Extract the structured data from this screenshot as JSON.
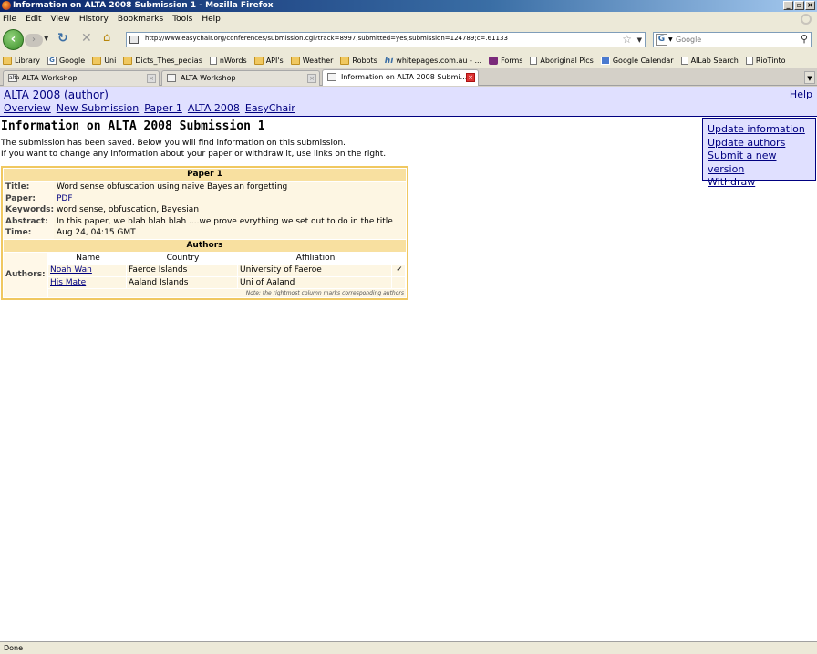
{
  "window": {
    "title": "Information on ALTA 2008 Submission 1 - Mozilla Firefox"
  },
  "menu": [
    "File",
    "Edit",
    "View",
    "History",
    "Bookmarks",
    "Tools",
    "Help"
  ],
  "toolbar": {
    "url": "http://www.easychair.org/conferences/submission.cgi?track=8997;submitted=yes;submission=124789;c=.61133",
    "search_placeholder": "Google"
  },
  "bookmarks": [
    {
      "label": "Library",
      "icon": "folder"
    },
    {
      "label": "Google",
      "icon": "google"
    },
    {
      "label": "Uni",
      "icon": "folder"
    },
    {
      "label": "Dicts_Thes_pedias",
      "icon": "folder"
    },
    {
      "label": "nWords",
      "icon": "page"
    },
    {
      "label": "API's",
      "icon": "folder"
    },
    {
      "label": "Weather",
      "icon": "folder"
    },
    {
      "label": "Robots",
      "icon": "folder"
    },
    {
      "label": "whitepages.com.au - ...",
      "icon": "hi"
    },
    {
      "label": "Forms",
      "icon": "forms"
    },
    {
      "label": "Aboriginal Pics",
      "icon": "page"
    },
    {
      "label": "Google Calendar",
      "icon": "calendar"
    },
    {
      "label": "AILab Search",
      "icon": "page"
    },
    {
      "label": "RioTinto",
      "icon": "page"
    }
  ],
  "tabs": [
    {
      "label": "ALTA Workshop",
      "active": false
    },
    {
      "label": "ALTA Workshop",
      "active": false
    },
    {
      "label": "Information on ALTA 2008 Submi...",
      "active": true
    }
  ],
  "header": {
    "title": "ALTA 2008 (author)",
    "help": "Help",
    "nav": [
      "Overview",
      "New Submission",
      "Paper 1",
      "ALTA 2008",
      "EasyChair"
    ]
  },
  "side_menu": [
    "Update information",
    "Update authors",
    "Submit a new version",
    "Withdraw"
  ],
  "page": {
    "title": "Information on ALTA 2008 Submission 1",
    "msg1": "The submission has been saved. Below you will find information on this submission.",
    "msg2": "If you want to change any information about your paper or withdraw it, use links on the right."
  },
  "paper": {
    "heading": "Paper 1",
    "fields": [
      {
        "label": "Title:",
        "value": "Word sense obfuscation using naive Bayesian forgetting"
      },
      {
        "label": "Paper:",
        "value": "PDF",
        "link": true
      },
      {
        "label": "Keywords:",
        "value": "word sense, obfuscation, Bayesian"
      },
      {
        "label": "Abstract:",
        "value": "In this paper, we blah blah blah ....we prove evrything we set out to do in the title"
      },
      {
        "label": "Time:",
        "value": "Aug 24, 04:15 GMT"
      }
    ],
    "authors_heading": "Authors",
    "authors_label": "Authors:",
    "author_columns": [
      "Name",
      "Country",
      "Affiliation",
      ""
    ],
    "authors": [
      {
        "name": "Noah Wan",
        "country": "Faeroe Islands",
        "affiliation": "University of Faeroe",
        "corresponding": "✓"
      },
      {
        "name": "His Mate",
        "country": "Aaland Islands",
        "affiliation": "Uni of Aaland",
        "corresponding": ""
      }
    ],
    "note": "Note: the rightmost column marks corresponding authors"
  },
  "status": "Done"
}
